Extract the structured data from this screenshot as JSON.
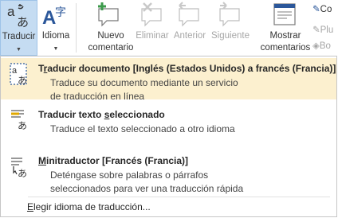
{
  "ribbon": {
    "traducir_label": "Traducir",
    "idioma_label": "Idioma",
    "nuevo_line1": "Nuevo",
    "nuevo_line2": "comentario",
    "eliminar_label": "Eliminar",
    "anterior_label": "Anterior",
    "siguiente_label": "Siguiente",
    "mostrar_line1": "Mostrar",
    "mostrar_line2": "comentarios",
    "small_items": [
      "Co",
      "Plu",
      "Bo"
    ]
  },
  "menu": {
    "items": [
      {
        "title_pre": "T",
        "title_ul": "r",
        "title_post": "aducir documento [Inglés (Estados Unidos) a francés (Francia)]",
        "desc_line1": "Traduce su documento mediante un servicio",
        "desc_line2": "de traducción en línea"
      },
      {
        "title_pre": "Traducir texto ",
        "title_ul": "s",
        "title_post": "eleccionado",
        "desc_line1": "Traduce el texto seleccionado a otro idioma"
      },
      {
        "title_pre": "",
        "title_ul": "M",
        "title_post": "initraductor [Francés (Francia)]",
        "desc_line1": "Deténgase sobre palabras o párrafos",
        "desc_line2": "seleccionados para ver una traducción rápida"
      }
    ],
    "footer_ul": "E",
    "footer_post": "legir idioma de traducción..."
  },
  "colors": {
    "selected_button_bg": "#c5dcf2",
    "hover_item_bg": "#fcf0cf",
    "icon_blue": "#2b579a",
    "icon_green": "#3c9a4b"
  }
}
